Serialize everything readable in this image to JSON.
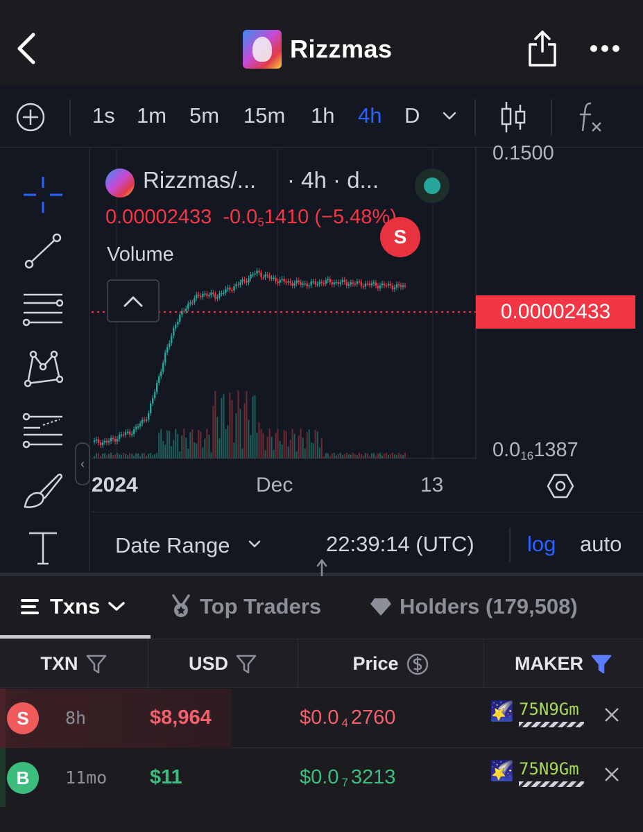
{
  "header": {
    "title": "Rizzmas"
  },
  "timeframes": [
    "1s",
    "1m",
    "5m",
    "15m",
    "1h",
    "4h",
    "D"
  ],
  "active_timeframe": "4h",
  "chart": {
    "symbol": "Rizzmas/...",
    "interval_suffix": "· 4h · d...",
    "ohlc_price": "0.00002433",
    "ohlc_change_prefix": "-0.0",
    "ohlc_change_sub": "5",
    "ohlc_change_tail": "1410 (−5.48%)",
    "volume_label": "Volume",
    "marker_label": "S",
    "last_price_tag": "0.00002433",
    "axis_top": "0.1500",
    "axis_bottom_prefix": "0.0",
    "axis_bottom_sub": "16",
    "axis_bottom_tail": "1387",
    "x_labels": [
      "2024",
      "Dec",
      "13"
    ]
  },
  "chart_data": {
    "type": "candlestick",
    "title": "Rizzmas/...",
    "y_scale": "log",
    "last_price": 2.433e-05,
    "change_pct": -5.48,
    "price_series": [
      3e-08,
      3e-08,
      4e-08,
      5e-08,
      1e-07,
      8e-07,
      5e-06,
      1.2e-05,
      1.8e-05,
      1.6e-05,
      2.2e-05,
      3e-05,
      4.5e-05,
      3.5e-05,
      3e-05,
      2.8e-05,
      2.7e-05,
      3e-05,
      2.9e-05,
      2.8e-05,
      2.7e-05,
      2.6e-05,
      2.5e-05,
      2.433e-05
    ],
    "x_tick_labels": [
      "2024",
      "Dec",
      "13"
    ]
  },
  "bottom_bar": {
    "date_range": "Date Range",
    "clock": "22:39:14 (UTC)",
    "log": "log",
    "auto": "auto"
  },
  "tabs": {
    "txns": "Txns",
    "top_traders": "Top Traders",
    "holders": "Holders (179,508)"
  },
  "table": {
    "headers": [
      "TXN",
      "USD",
      "Price",
      "MAKER"
    ],
    "rows": [
      {
        "type": "S",
        "age": "8h",
        "usd": "$8,964",
        "price_prefix": "$0.0",
        "price_sub": "4",
        "price_tail": "2760",
        "maker_emoji": "🌠",
        "maker": "75N9Gm",
        "color": "#f0616d"
      },
      {
        "type": "B",
        "age": "11mo",
        "usd": "$11",
        "price_prefix": "$0.0",
        "price_sub": "7",
        "price_tail": "3213",
        "maker_emoji": "🌠",
        "maker": "75N9Gm",
        "color": "#3dbd7d"
      }
    ]
  },
  "colors": {
    "accent_blue": "#2962ff",
    "sell_red": "#f23645",
    "buy_green": "#26a69a"
  }
}
